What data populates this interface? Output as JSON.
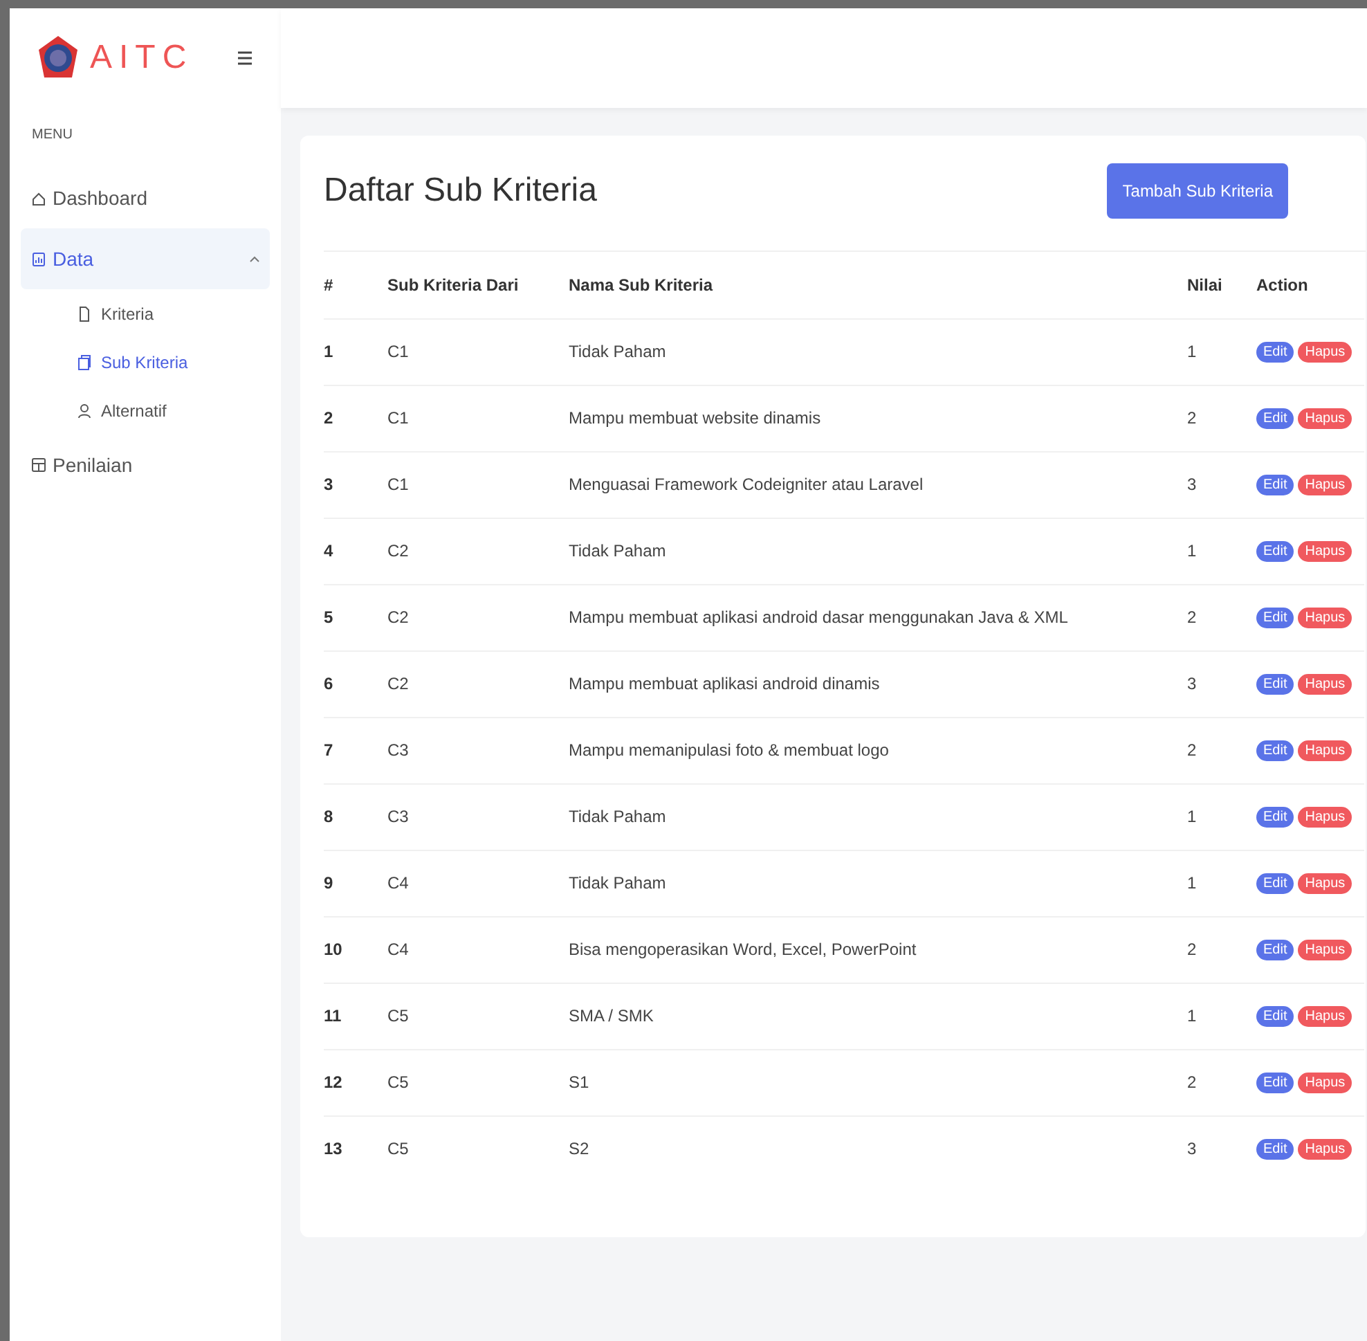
{
  "brand": {
    "name": "AITC"
  },
  "sidebar": {
    "heading": "MENU",
    "items": [
      {
        "kind": "home",
        "label": "Dashboard",
        "selected": false
      },
      {
        "kind": "data",
        "label": "Data",
        "selected": true,
        "expanded": true,
        "children": [
          {
            "kind": "file",
            "label": "Kriteria",
            "selected": false
          },
          {
            "kind": "copy",
            "label": "Sub Kriteria",
            "selected": true
          },
          {
            "kind": "user",
            "label": "Alternatif",
            "selected": false
          }
        ]
      },
      {
        "kind": "calc",
        "label": "Penilaian",
        "selected": false
      }
    ]
  },
  "card": {
    "title": "Daftar Sub Kriteria",
    "add_button": "Tambah Sub Kriteria"
  },
  "table": {
    "columns": [
      "#",
      "Sub Kriteria Dari",
      "Nama Sub Kriteria",
      "Nilai",
      "Action"
    ],
    "rows": [
      {
        "no": "1",
        "from": "C1",
        "name": "Tidak Paham",
        "value": "1",
        "actions": [
          "Edit",
          "Hapus"
        ]
      },
      {
        "no": "2",
        "from": "C1",
        "name": "Mampu membuat website dinamis",
        "value": "2",
        "actions": [
          "Edit",
          "Hapus"
        ]
      },
      {
        "no": "3",
        "from": "C1",
        "name": "Menguasai Framework Codeigniter atau Laravel",
        "value": "3",
        "actions": [
          "Edit",
          "Hapus"
        ]
      },
      {
        "no": "4",
        "from": "C2",
        "name": "Tidak Paham",
        "value": "1",
        "actions": [
          "Edit",
          "Hapus"
        ]
      },
      {
        "no": "5",
        "from": "C2",
        "name": "Mampu membuat aplikasi android dasar menggunakan Java & XML",
        "value": "2",
        "actions": [
          "Edit",
          "Hapus"
        ]
      },
      {
        "no": "6",
        "from": "C2",
        "name": "Mampu membuat aplikasi android dinamis",
        "value": "3",
        "actions": [
          "Edit",
          "Hapus"
        ]
      },
      {
        "no": "7",
        "from": "C3",
        "name": "Mampu memanipulasi foto & membuat logo",
        "value": "2",
        "actions": [
          "Edit",
          "Hapus"
        ]
      },
      {
        "no": "8",
        "from": "C3",
        "name": "Tidak Paham",
        "value": "1",
        "actions": [
          "Edit",
          "Hapus"
        ]
      },
      {
        "no": "9",
        "from": "C4",
        "name": "Tidak Paham",
        "value": "1",
        "actions": [
          "Edit",
          "Hapus"
        ]
      },
      {
        "no": "10",
        "from": "C4",
        "name": "Bisa mengoperasikan Word, Excel, PowerPoint",
        "value": "2",
        "actions": [
          "Edit",
          "Hapus"
        ]
      },
      {
        "no": "11",
        "from": "C5",
        "name": "SMA / SMK",
        "value": "1",
        "actions": [
          "Edit",
          "Hapus"
        ]
      },
      {
        "no": "12",
        "from": "C5",
        "name": "S1",
        "value": "2",
        "actions": [
          "Edit",
          "Hapus"
        ]
      },
      {
        "no": "13",
        "from": "C5",
        "name": "S2",
        "value": "3",
        "actions": [
          "Edit",
          "Hapus"
        ]
      }
    ]
  }
}
